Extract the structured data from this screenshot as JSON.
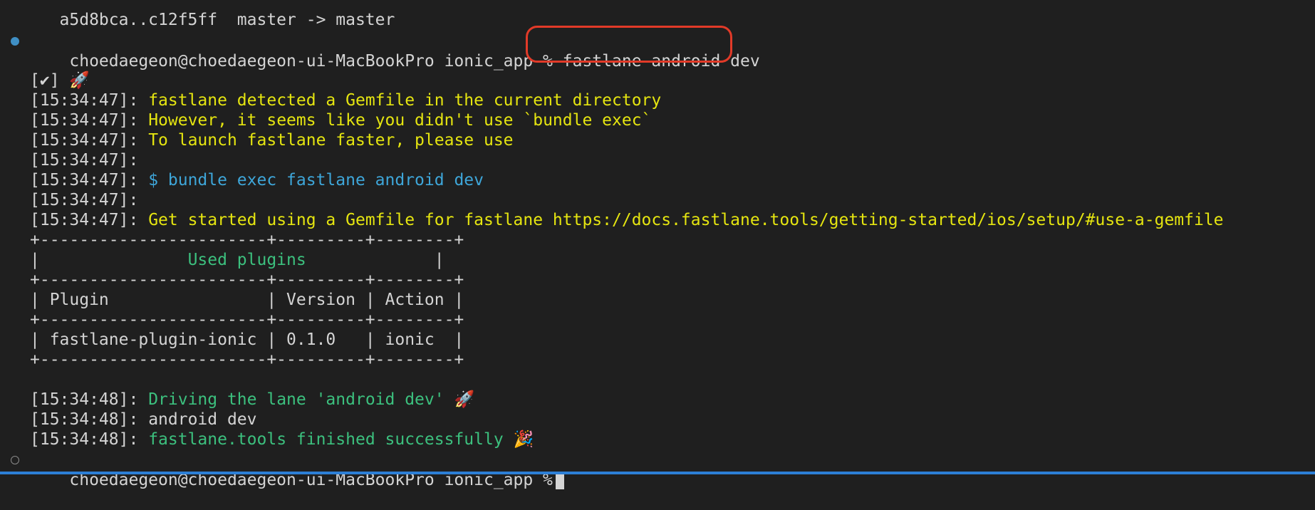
{
  "terminal": {
    "git_push_result": "   a5d8bca..c12f5ff  master -> master",
    "prompt": "choedaegeon@choedaegeon-ui-MacBookPro ionic_app %",
    "command": "fastlane android dev",
    "checkmark_line": "[✔] 🚀",
    "lines": [
      {
        "ts": "[15:34:47]:",
        "text": "fastlane detected a Gemfile in the current directory",
        "color": "yellow"
      },
      {
        "ts": "[15:34:47]:",
        "text": "However, it seems like you didn't use `bundle exec`",
        "color": "yellow"
      },
      {
        "ts": "[15:34:47]:",
        "text": "To launch fastlane faster, please use",
        "color": "yellow"
      },
      {
        "ts": "[15:34:47]:",
        "text": "",
        "color": "yellow"
      },
      {
        "ts": "[15:34:47]:",
        "text": "$ bundle exec fastlane android dev",
        "color": "cyan"
      },
      {
        "ts": "[15:34:47]:",
        "text": "",
        "color": "yellow"
      },
      {
        "ts": "[15:34:47]:",
        "text": "Get started using a Gemfile for fastlane https://docs.fastlane.tools/getting-started/ios/setup/#use-a-gemfile",
        "color": "yellow"
      }
    ],
    "plugin_table": {
      "border": "+-----------------------+---------+--------+",
      "title_left": "|               ",
      "title": "Used plugins",
      "title_right": "             |",
      "header_row": "| Plugin                | Version | Action |",
      "data_row": "| fastlane-plugin-ionic | 0.1.0   | ionic  |"
    },
    "lane_lines": [
      {
        "ts": "[15:34:48]:",
        "text": "Driving the lane 'android dev' 🚀",
        "color": "green"
      },
      {
        "ts": "[15:34:48]:",
        "text": "android dev",
        "color": "default"
      },
      {
        "ts": "[15:34:48]:",
        "text": "fastlane.tools finished successfully 🎉",
        "color": "green"
      }
    ]
  },
  "colors": {
    "background": "#1f1f1f",
    "highlight_box": "#e23a28",
    "status_bar": "#2c7fd6"
  }
}
